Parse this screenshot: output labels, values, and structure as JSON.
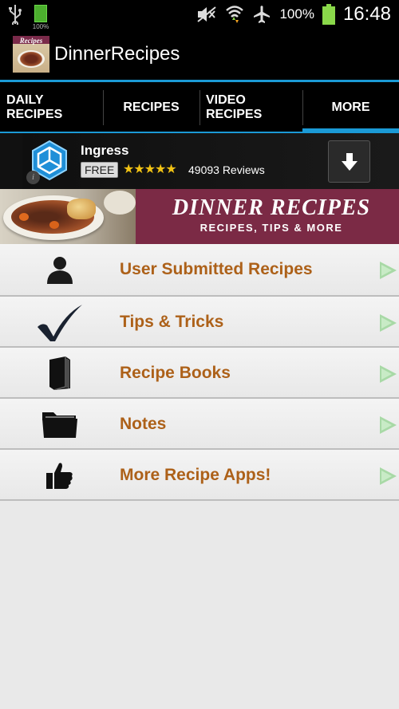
{
  "status_bar": {
    "mini_battery_percent": "100%",
    "battery_percent": "100%",
    "time": "16:48",
    "icons": [
      "usb-icon",
      "battery-small-icon",
      "mute-icon",
      "wifi-icon",
      "airplane-icon",
      "battery-icon"
    ]
  },
  "app_bar": {
    "title": "DinnerRecipes",
    "logo_text": "Recipes"
  },
  "tabs": [
    {
      "label": "DAILY RECIPES",
      "active": false
    },
    {
      "label": "RECIPES",
      "active": false
    },
    {
      "label": "VIDEO RECIPES",
      "active": false
    },
    {
      "label": "MORE",
      "active": true
    }
  ],
  "ad": {
    "app_name": "Ingress",
    "price": "FREE",
    "stars": "★★★★★",
    "rating_value": 4.5,
    "reviews": "49093 Reviews",
    "info": "i"
  },
  "hero": {
    "title": "DINNER RECIPES",
    "subtitle": "RECIPES, TIPS & MORE"
  },
  "menu": [
    {
      "label": "User Submitted Recipes",
      "icon": "user-icon"
    },
    {
      "label": "Tips & Tricks",
      "icon": "checkmark-icon"
    },
    {
      "label": "Recipe Books",
      "icon": "book-icon"
    },
    {
      "label": "Notes",
      "icon": "folder-icon"
    },
    {
      "label": "More Recipe Apps!",
      "icon": "thumbs-up-icon"
    }
  ],
  "colors": {
    "accent": "#1b9ad6",
    "menu_text": "#ad6119",
    "banner": "#7b2a45",
    "arrow": "#a8d9a6"
  }
}
